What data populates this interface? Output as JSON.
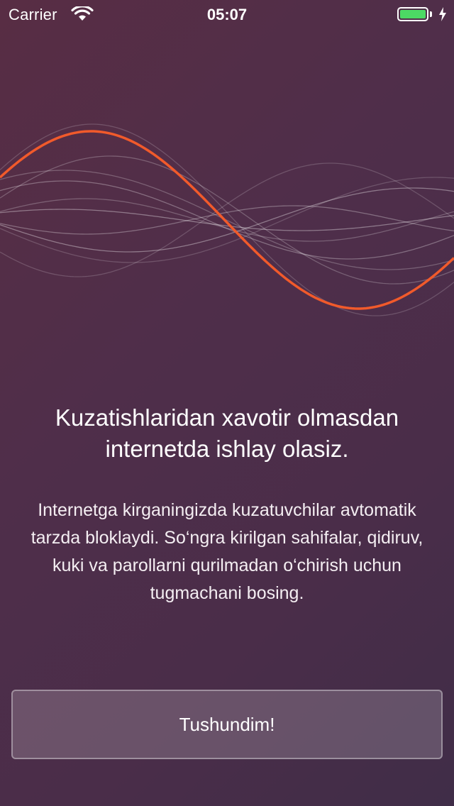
{
  "status_bar": {
    "carrier": "Carrier",
    "time": "05:07",
    "battery_level": 1.0,
    "battery_color": "#4cd964",
    "charging": true,
    "icons": [
      "wifi-icon",
      "battery-icon",
      "charging-bolt-icon"
    ]
  },
  "hero": {
    "accent_color": "#f15a2b",
    "illustration": "sound-wave-illustration"
  },
  "onboarding": {
    "headline": "Kuzatishlaridan xavotir olmasdan internetda ishlay olasiz.",
    "description": "Internetga kirganingizda kuzatuvchilar avtomatik tarzda bloklaydi. So‘ngra kirilgan sahifalar, qidiruv, kuki va parollarni qurilmadan o‘chirish uchun tugmachani bosing."
  },
  "actions": {
    "primary_label": "Tushundim!"
  }
}
